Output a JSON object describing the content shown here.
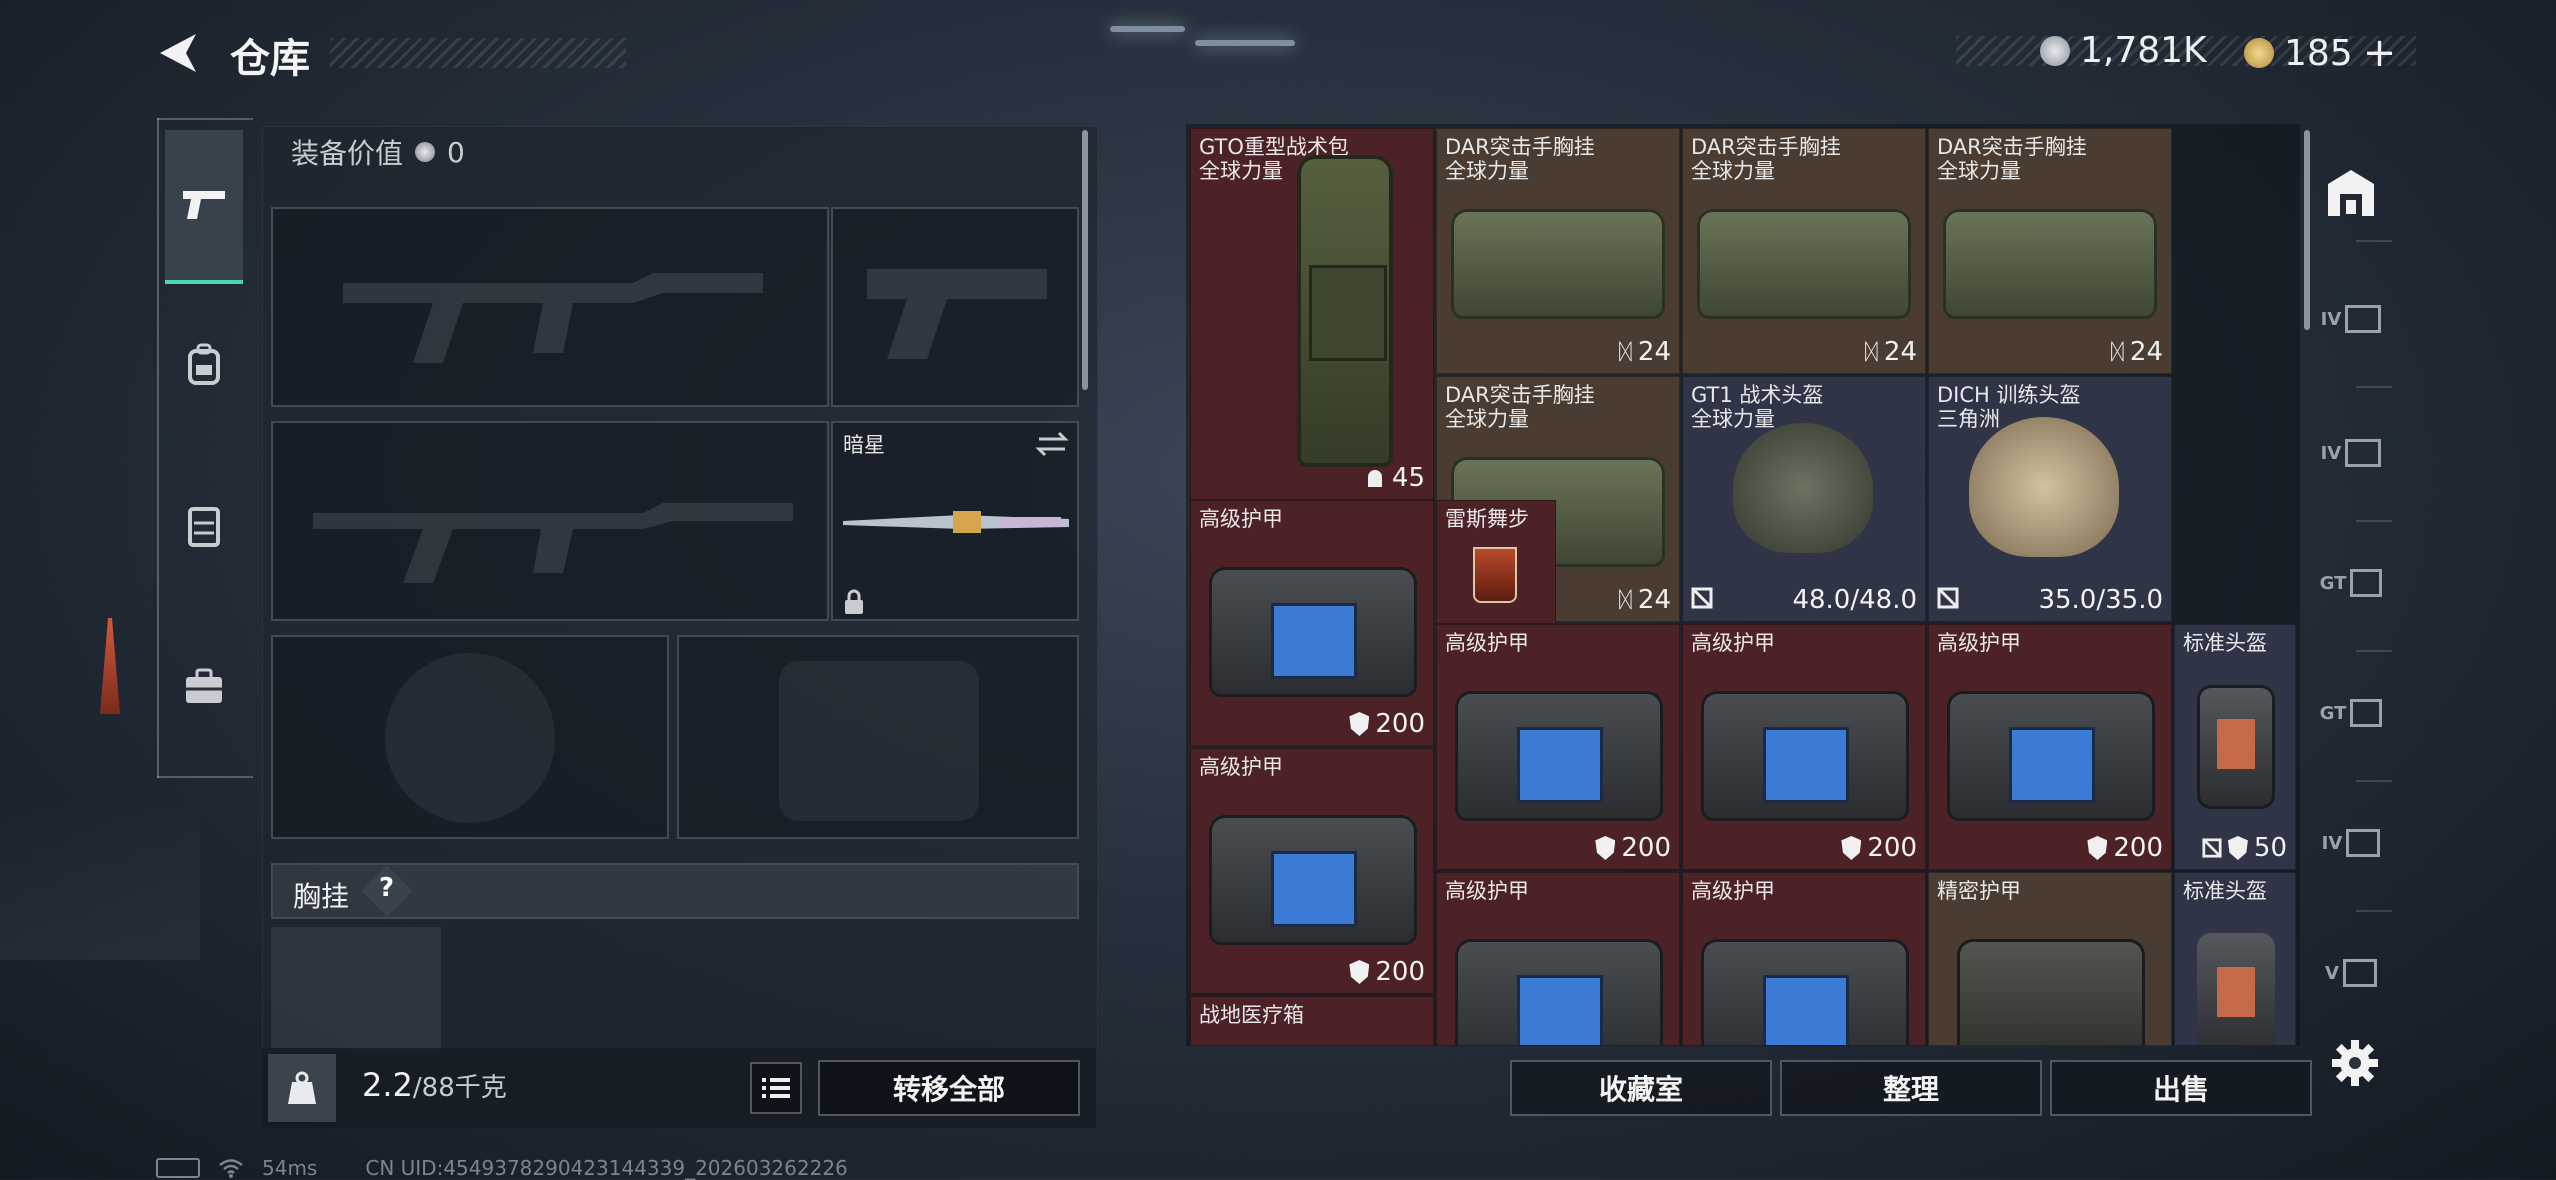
{
  "header": {
    "title": "仓库",
    "silver": "1,781K",
    "gold": "185",
    "plus": "+"
  },
  "loadout": {
    "value_label": "装备价值",
    "value": "0",
    "melee_name": "暗星",
    "chest_label": "胸挂",
    "help": "?"
  },
  "capacity": {
    "current": "2.2",
    "max": "/88千克"
  },
  "buttons": {
    "transfer_all": "转移全部",
    "collection": "收藏室",
    "organize": "整理",
    "sell": "出售"
  },
  "items": [
    {
      "name": "GTO重型战术包",
      "sub": "全球力量",
      "badge": "45"
    },
    {
      "name": "DAR突击手胸挂",
      "sub": "全球力量",
      "badge": "24"
    },
    {
      "name": "DAR突击手胸挂",
      "sub": "全球力量",
      "badge": "24"
    },
    {
      "name": "DAR突击手胸挂",
      "sub": "全球力量",
      "badge": "24"
    },
    {
      "name": "DAR突击手胸挂",
      "sub": "全球力量",
      "badge": "24"
    },
    {
      "name": "GT1 战术头盔",
      "sub": "全球力量",
      "badge": "48.0/48.0"
    },
    {
      "name": "DICH 训练头盔",
      "sub": "三角洲",
      "badge": "35.0/35.0"
    },
    {
      "name": "高级护甲",
      "badge": "200"
    },
    {
      "name": "雷斯舞步"
    },
    {
      "name": "高级护甲",
      "badge": "200"
    },
    {
      "name": "高级护甲",
      "badge": "200"
    },
    {
      "name": "高级护甲",
      "badge": "200"
    },
    {
      "name": "标准头盔",
      "badge": "50"
    },
    {
      "name": "高级护甲",
      "badge": "200"
    },
    {
      "name": "战地医疗箱"
    },
    {
      "name": "高级护甲"
    },
    {
      "name": "高级护甲"
    },
    {
      "name": "精密护甲"
    },
    {
      "name": "标准头盔"
    }
  ],
  "status": {
    "ping": "54ms",
    "uid": "CN UID:4549378290423144339_202603262226"
  },
  "rail": {
    "r1": "IV",
    "r2": "IV",
    "r3": "GT",
    "r4": "GT",
    "r5": "IV",
    "r6": "V"
  },
  "colors": {
    "accent": "#4bd5b4",
    "rare_red": "#4c2227",
    "epic_brown": "#4a3c30",
    "blue": "#2f3447"
  }
}
